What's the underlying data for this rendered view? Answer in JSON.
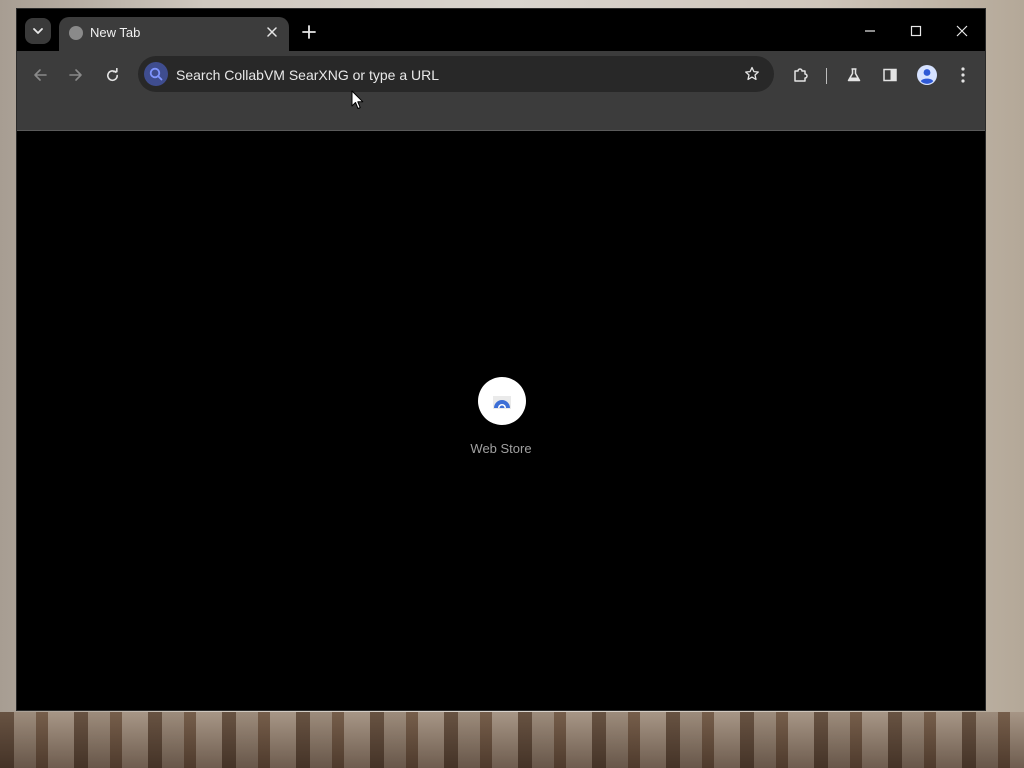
{
  "tabs": [
    {
      "title": "New Tab",
      "active": true
    }
  ],
  "omnibox": {
    "placeholder": "Search CollabVM SearXNG or type a URL",
    "value": ""
  },
  "new_tab_page": {
    "shortcuts": [
      {
        "label": "Web Store",
        "icon": "webstore-icon"
      }
    ]
  },
  "icons": {
    "tab_search": "chevron-down-icon",
    "favicon": "globe-icon",
    "tab_close": "close-icon",
    "new_tab": "plus-icon",
    "minimize": "minimize-icon",
    "maximize": "maximize-icon",
    "close_window": "close-icon",
    "back": "arrow-left-icon",
    "forward": "arrow-right-icon",
    "reload": "reload-icon",
    "search_engine": "search-icon",
    "bookmark": "star-icon",
    "extensions": "puzzle-icon",
    "labs": "flask-icon",
    "side_panel": "side-panel-icon",
    "profile": "avatar-icon",
    "menu": "kebab-menu-icon"
  },
  "colors": {
    "content_background": "#000000",
    "toolbar_background": "#3c3c3c",
    "omnibox_background": "#282828",
    "accent": "#4d6ae8"
  }
}
